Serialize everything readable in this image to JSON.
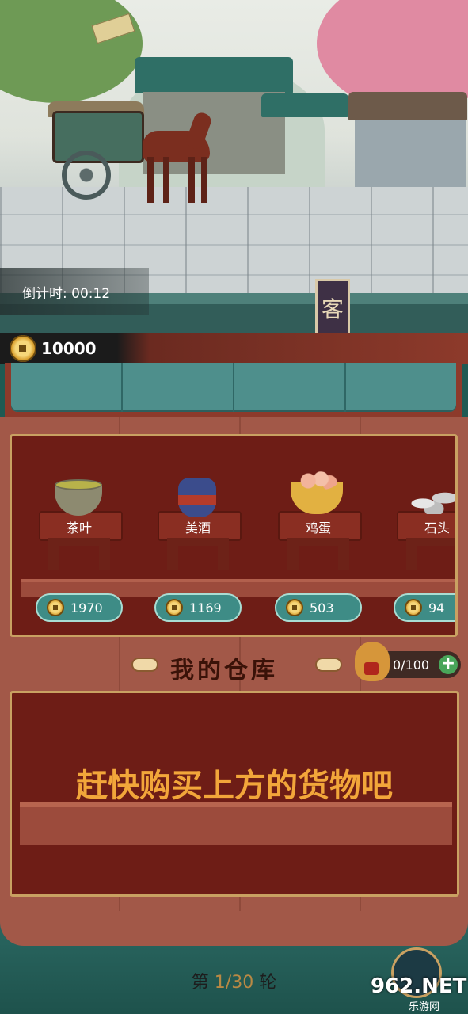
{
  "hud": {
    "countdown": "倒计时: 00:12",
    "money": "10000",
    "flag_text": "客"
  },
  "shop": {
    "items": [
      {
        "name": "茶叶",
        "price": "1970",
        "icon": "tea-icon"
      },
      {
        "name": "美酒",
        "price": "1169",
        "icon": "wine-jar-icon"
      },
      {
        "name": "鸡蛋",
        "price": "503",
        "icon": "egg-basket-icon"
      },
      {
        "name": "石头",
        "price": "94",
        "icon": "stone-icon"
      }
    ]
  },
  "warehouse": {
    "title": "我的仓库",
    "capacity": "0/100",
    "add_label": "+",
    "empty_hint": "赶快购买上方的货物吧"
  },
  "footer": {
    "round_prefix": "第",
    "round_value": "1/30",
    "round_suffix": "轮"
  },
  "watermark": {
    "main": "962.NET",
    "sub": "乐游网"
  },
  "colors": {
    "awning": "#4e8f8c",
    "panel": "#6e1d16",
    "gold": "#c9a162",
    "hint": "#f2a63a",
    "price_tag": "#3e8c86"
  }
}
